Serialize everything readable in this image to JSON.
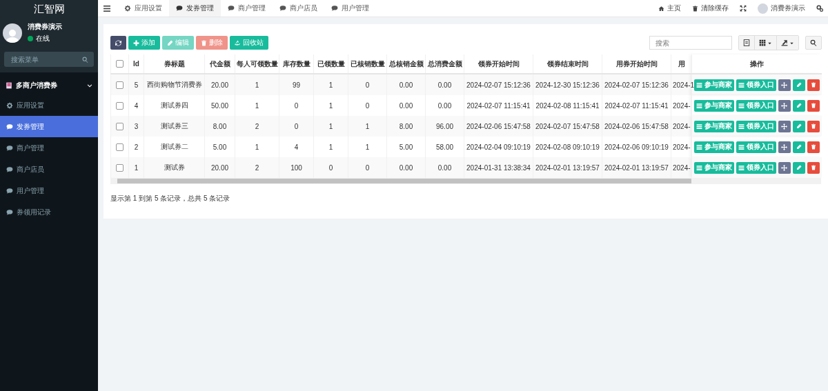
{
  "brand": "汇智网",
  "user": {
    "name": "消费券演示",
    "status": "在线",
    "online": true
  },
  "sidebar": {
    "search_placeholder": "搜索菜单",
    "group": {
      "label": "多商户消费券",
      "expanded": true,
      "items": [
        {
          "kind": "gear",
          "label": "应用设置",
          "selected": false
        },
        {
          "kind": "comment",
          "label": "发券管理",
          "selected": true
        },
        {
          "kind": "comment",
          "label": "商户管理",
          "selected": false
        },
        {
          "kind": "comment",
          "label": "商户店员",
          "selected": false
        },
        {
          "kind": "comment",
          "label": "用户管理",
          "selected": false
        },
        {
          "kind": "comment",
          "label": "券领用记录",
          "selected": false
        }
      ]
    }
  },
  "topnav": {
    "tabs": [
      {
        "kind": "gear",
        "label": "应用设置",
        "selected": false
      },
      {
        "kind": "comment",
        "label": "发券管理",
        "selected": true
      },
      {
        "kind": "comment",
        "label": "商户管理",
        "selected": false
      },
      {
        "kind": "comment",
        "label": "商户店员",
        "selected": false
      },
      {
        "kind": "comment",
        "label": "用户管理",
        "selected": false
      }
    ],
    "right": [
      {
        "kind": "home",
        "label": "主页"
      },
      {
        "kind": "trash",
        "label": "清除缓存"
      },
      {
        "kind": "expand"
      },
      {
        "kind": "user",
        "label": "消费券演示"
      },
      {
        "kind": "gears"
      }
    ]
  },
  "toolbar": {
    "buttons": [
      {
        "kind": "refresh",
        "disabled": false
      },
      {
        "kind": "plus",
        "label": "添加",
        "disabled": false
      },
      {
        "kind": "pencil",
        "label": "编辑",
        "disabled": true
      },
      {
        "kind": "trash",
        "label": "删除",
        "disabled": true
      },
      {
        "kind": "recycle",
        "label": "回收站",
        "disabled": false
      }
    ],
    "search_placeholder": "搜索",
    "tools": [
      {
        "kind": "toggle"
      },
      {
        "kind": "columns"
      },
      {
        "kind": "export"
      },
      {
        "kind": "search"
      }
    ]
  },
  "table": {
    "header_checked": false,
    "columns": [
      "Id",
      "券标题",
      "代金额",
      "每人可领数量",
      "库存数量",
      "已领数量",
      "已核销数量",
      "总核销金额",
      "总消费金额",
      "领券开始时间",
      "领券结束时间",
      "用券开始时间",
      "用",
      "操作"
    ],
    "rows": [
      {
        "checked": false,
        "cells": [
          "5",
          "西街购物节消费券",
          "20.00",
          "1",
          "99",
          "1",
          "0",
          "0.00",
          "0.00",
          "2024-02-07 15:12:36",
          "2024-12-30 15:12:36",
          "2024-02-07 15:12:36",
          "2024-1"
        ],
        "actions": [
          "参与商家",
          "领券入口"
        ]
      },
      {
        "checked": false,
        "cells": [
          "4",
          "测试券四",
          "50.00",
          "1",
          "0",
          "1",
          "0",
          "0.00",
          "0.00",
          "2024-02-07 11:15:41",
          "2024-02-08 11:15:41",
          "2024-02-07 11:15:41",
          "2024-"
        ],
        "actions": [
          "参与商家",
          "领券入口"
        ]
      },
      {
        "checked": false,
        "cells": [
          "3",
          "测试券三",
          "8.00",
          "2",
          "0",
          "1",
          "1",
          "8.00",
          "96.00",
          "2024-02-06 15:47:58",
          "2024-02-07 15:47:58",
          "2024-02-06 15:47:58",
          "2024-"
        ],
        "actions": [
          "参与商家",
          "领券入口"
        ]
      },
      {
        "checked": false,
        "cells": [
          "2",
          "测试券二",
          "5.00",
          "1",
          "4",
          "1",
          "1",
          "5.00",
          "58.00",
          "2024-02-04 09:10:19",
          "2024-02-08 09:10:19",
          "2024-02-06 09:10:19",
          "2024-"
        ],
        "actions": [
          "参与商家",
          "领券入口"
        ]
      },
      {
        "checked": false,
        "cells": [
          "1",
          "测试券",
          "20.00",
          "2",
          "100",
          "0",
          "0",
          "0.00",
          "0.00",
          "2024-01-31 13:38:34",
          "2024-02-01 13:19:57",
          "2024-02-01 13:19:57",
          "2024-"
        ],
        "actions": [
          "参与商家",
          "领券入口"
        ]
      }
    ]
  },
  "pagination_info": "显示第 1 到第 5 条记录，总共 5 条记录"
}
